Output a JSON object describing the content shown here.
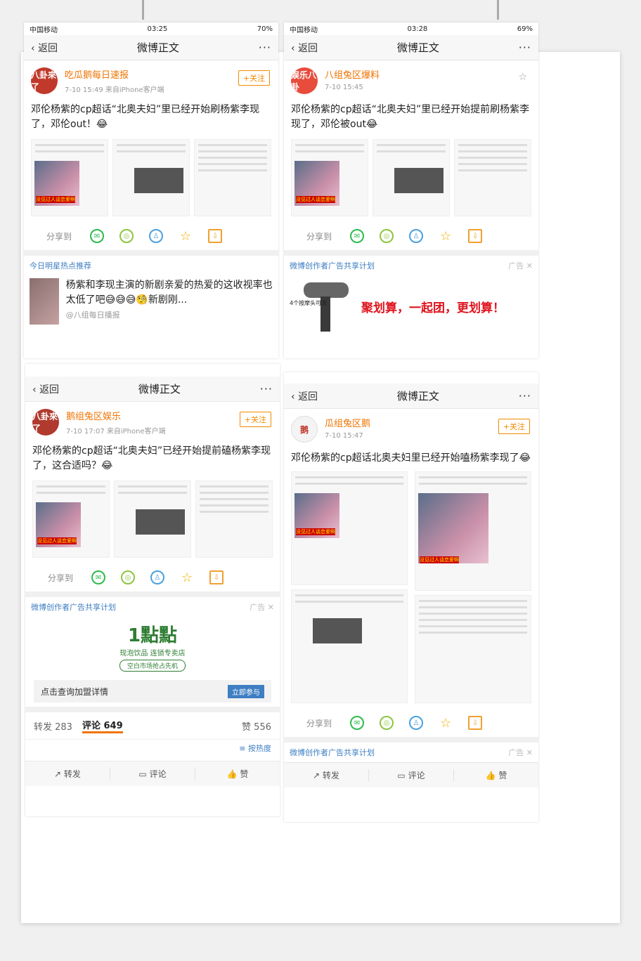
{
  "status": {
    "carrier": "中国移动",
    "p1": {
      "time": "03:25",
      "battery": "70%"
    },
    "p2": {
      "time": "03:28",
      "battery": "69%"
    }
  },
  "nav": {
    "back": "返回",
    "title": "微博正文"
  },
  "share_label": "分享到",
  "follow_label": "+关注",
  "posts": [
    {
      "user": "吃瓜鹅每日速报",
      "avatar_text": "八卦來了",
      "avatar_color": "#c0392b",
      "meta": "7-10 15:49  来自iPhone客户端",
      "text": "邓伦杨紫的cp超话“北奥夫妇”里已经开始刷杨紫李现了，邓伦out！😂"
    },
    {
      "user": "八组兔区爆料",
      "avatar_text": "娱乐八卦",
      "avatar_color": "#e74c3c",
      "meta": "7-10 15:45",
      "text": "邓伦杨紫的cp超话“北奥夫妇”里已经开始提前刷杨紫李现了，邓伦被out😂"
    },
    {
      "user": "鹅组兔区娱乐",
      "avatar_text": "八卦來了",
      "avatar_color": "#b03a2e",
      "meta": "7-10 17:07  来自iPhone客户端",
      "text": "邓伦杨紫的cp超话“北奥夫妇”已经开始提前磕杨紫李现了，这合适吗？😂"
    },
    {
      "user": "瓜组兔区鹅",
      "avatar_text": "鹅",
      "avatar_color": "#f4f4f4",
      "meta": "7-10 15:47",
      "text": "邓伦杨紫的cp超话北奥夫妇里已经开始嗑杨紫李现了😂"
    }
  ],
  "hot": {
    "header": "今日明星热点推荐",
    "title": "杨紫和李现主演的新剧亲爱的热爱的这收视率也太低了吧😅😅😅🧐新剧刚...",
    "source": "@八组每日播报"
  },
  "ad1": {
    "header": "微博创作者广告共享计划",
    "ad_label": "广告",
    "caption": "4个按摩头可选",
    "slogan": "聚划算，一起团，更划算！"
  },
  "ad2": {
    "header": "微博创作者广告共享计划",
    "ad_label": "广告",
    "brand": "1點點",
    "brand_sub": "现泡饮品 连锁专卖店",
    "brand_tag": "空白市场抢占先机",
    "cta_text": "点击查询加盟详情",
    "cta_button": "立即参与"
  },
  "stats": {
    "repost": "转发 283",
    "comment": "评论 649",
    "like": "赞 556",
    "sort": "按热度"
  },
  "ad3": {
    "header": "微博创作者广告共享计划",
    "ad_label": "广告"
  },
  "actions": {
    "repost": "转发",
    "comment": "评论",
    "like": "赞"
  },
  "shot_caption": "没见过人谈恋爱啊"
}
